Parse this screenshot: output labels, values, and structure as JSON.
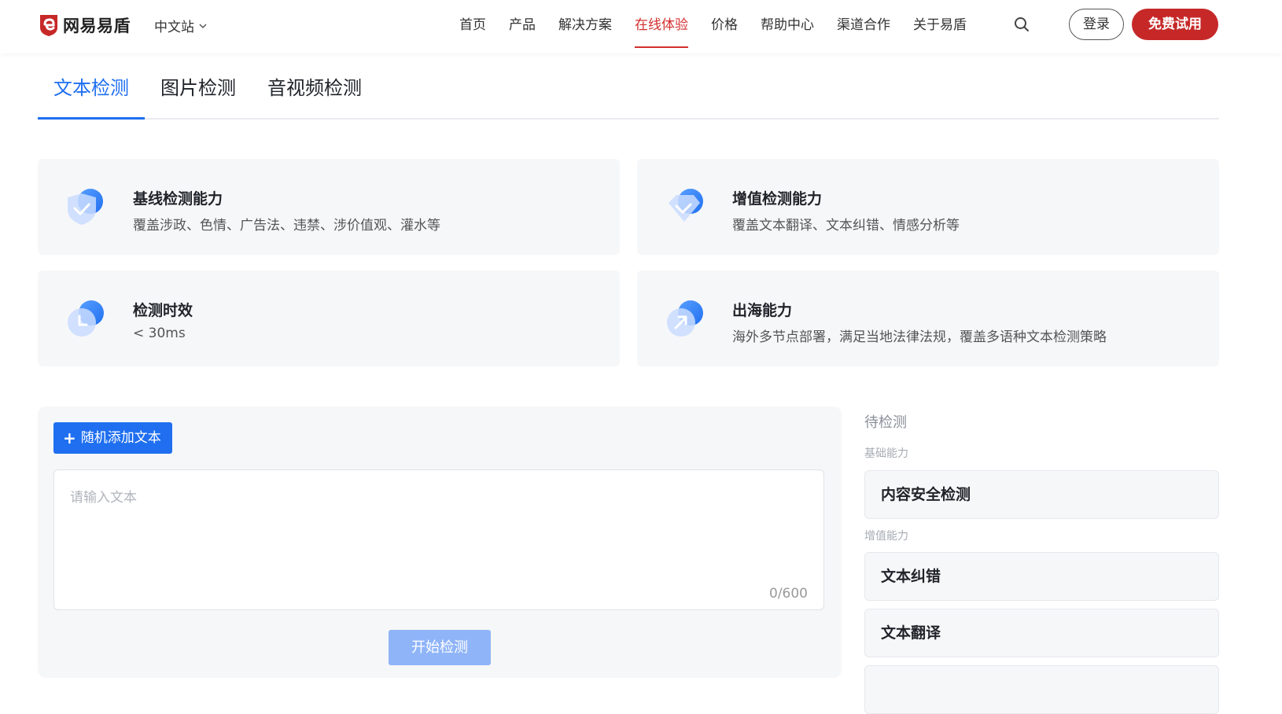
{
  "header": {
    "logo_text": "网易易盾",
    "site_switch": "中文站",
    "nav": [
      "首页",
      "产品",
      "解决方案",
      "在线体验",
      "价格",
      "帮助中心",
      "渠道合作",
      "关于易盾"
    ],
    "nav_active_index": 3,
    "login_label": "登录",
    "trial_label": "免费试用",
    "brand_color": "#c62828"
  },
  "tabs": {
    "items": [
      "文本检测",
      "图片检测",
      "音视频检测"
    ],
    "active_index": 0,
    "accent_color": "#1f6ff0"
  },
  "features": [
    {
      "icon": "shield-check-icon",
      "title": "基线检测能力",
      "desc": "覆盖涉政、色情、广告法、违禁、涉价值观、灌水等"
    },
    {
      "icon": "value-check-icon",
      "title": "增值检测能力",
      "desc": "覆盖文本翻译、文本纠错、情感分析等"
    },
    {
      "icon": "clock-icon",
      "title": "检测时效",
      "desc": "< 30ms"
    },
    {
      "icon": "arrow-up-right-icon",
      "title": "出海能力",
      "desc": "海外多节点部署，满足当地法律法规，覆盖多语种文本检测策略"
    }
  ],
  "input_panel": {
    "add_button_label": "随机添加文本",
    "placeholder": "请输入文本",
    "counter": "0/600",
    "start_button_label": "开始检测"
  },
  "pending": {
    "title": "待检测",
    "groups": [
      {
        "label": "基础能力",
        "items": [
          "内容安全检测"
        ]
      },
      {
        "label": "增值能力",
        "items": [
          "文本纠错",
          "文本翻译"
        ]
      }
    ]
  }
}
